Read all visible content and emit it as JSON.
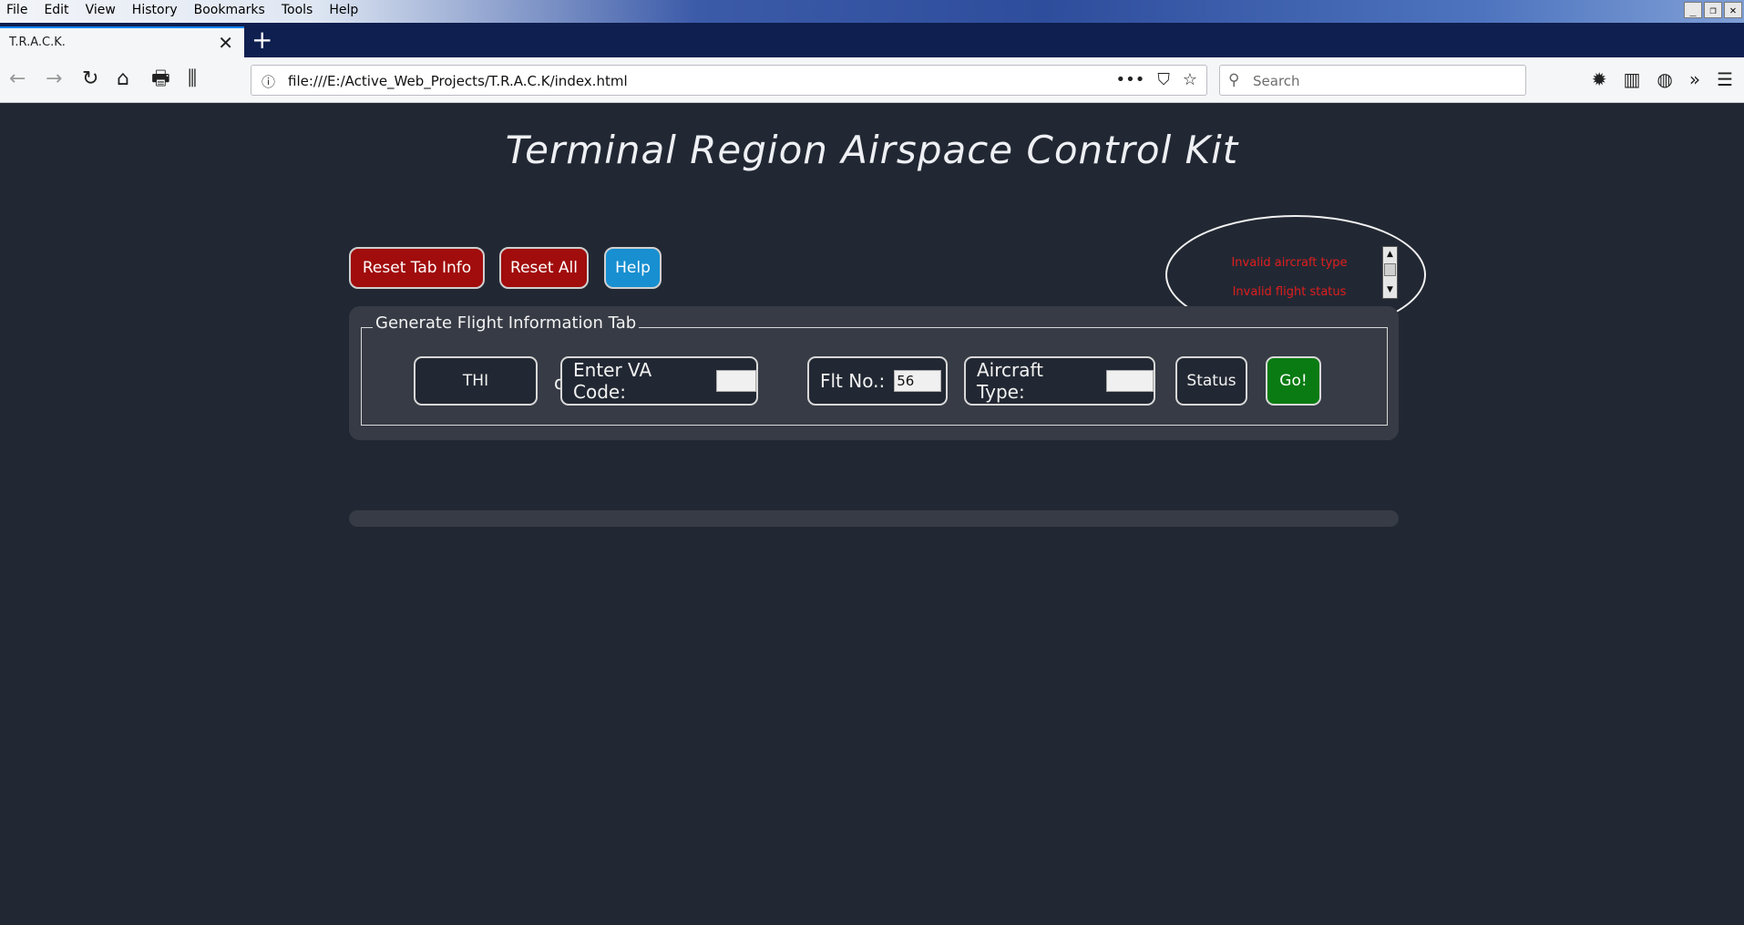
{
  "browser": {
    "menu": [
      "File",
      "Edit",
      "View",
      "History",
      "Bookmarks",
      "Tools",
      "Help"
    ],
    "window_controls": [
      "_",
      "❐",
      "✕"
    ],
    "tab": {
      "title": "T.R.A.C.K.",
      "close": "✕"
    },
    "new_tab": "+",
    "nav": {
      "back": "←",
      "forward": "→",
      "reload": "↻",
      "home": "⌂",
      "print": "🖶",
      "library": "⫼"
    },
    "url_info": "ⓘ",
    "url": "file:///E:/Active_Web_Projects/T.R.A.C.K/index.html",
    "url_actions": {
      "more": "•••",
      "pocket": "⛉",
      "bookmark": "☆"
    },
    "search": {
      "icon": "⚲",
      "placeholder": "Search"
    },
    "toolbar_icons": {
      "settings": "✹",
      "sidebar": "▥",
      "extension": "◍",
      "overflow": "»",
      "menu": "☰"
    }
  },
  "page": {
    "title": "Terminal Region Airspace Control Kit",
    "buttons": {
      "reset_tab": "Reset Tab Info",
      "reset_all": "Reset All",
      "help": "Help"
    },
    "errors": [
      "Invalid aircraft type",
      "Invalid flight status"
    ],
    "scroll": {
      "up": "▲",
      "down": "▼"
    },
    "form": {
      "legend": "Generate Flight Information Tab",
      "airline": "THI",
      "or": "or",
      "va_code_label": "Enter VA Code:",
      "va_code_value": "",
      "flt_no_label": "Flt No.:",
      "flt_no_value": "56",
      "aircraft_type_label": "Aircraft Type:",
      "aircraft_type_value": "",
      "status": "Status",
      "go": "Go!"
    }
  },
  "colors": {
    "page_bg": "#222833",
    "panel_bg": "#363b45",
    "danger": "#a10c0c",
    "info": "#178fd0",
    "success": "#0a7b12",
    "error_text": "#e01e1e"
  }
}
